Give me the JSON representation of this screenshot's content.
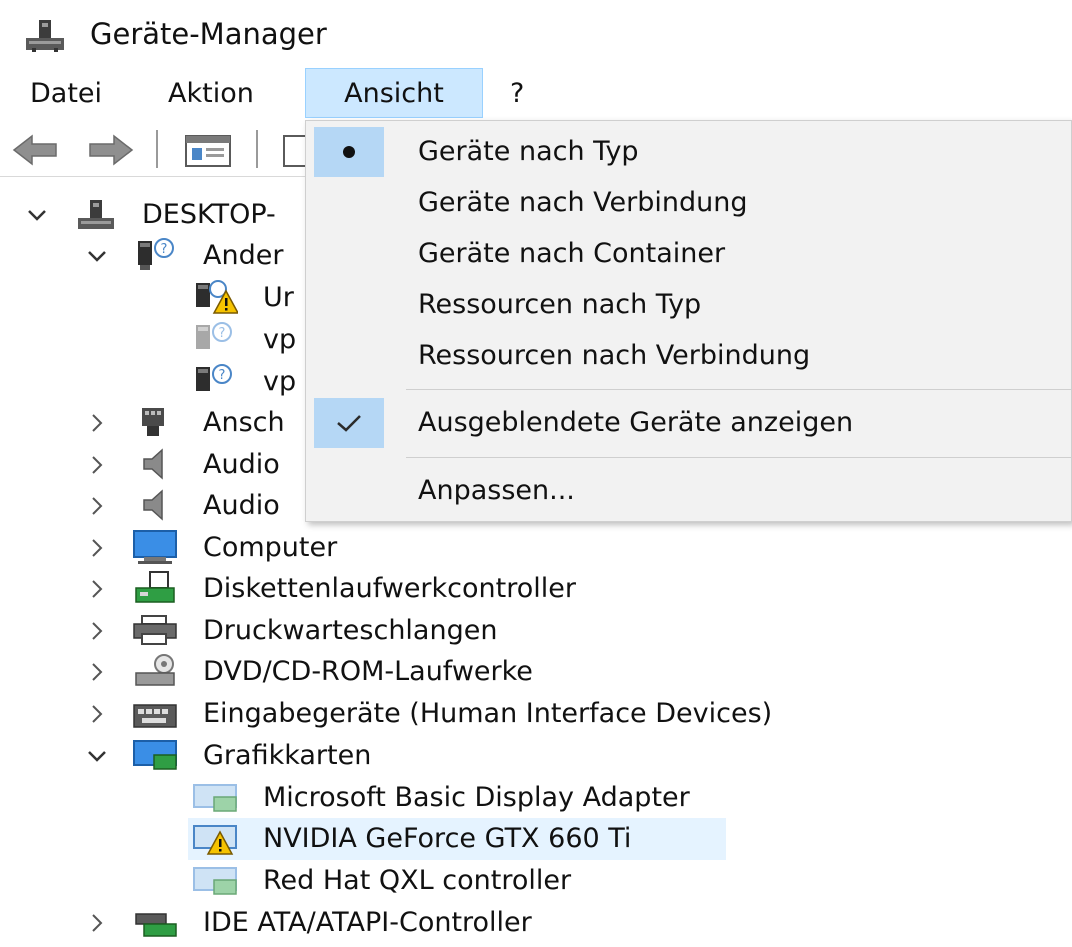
{
  "window": {
    "title": "Geräte-Manager"
  },
  "menubar": {
    "items": [
      "Datei",
      "Aktion",
      "Ansicht",
      "?"
    ]
  },
  "tree": {
    "root": "DESKTOP-",
    "other_devices": "Ander",
    "other_children": [
      "Ur",
      "vp",
      "vp"
    ],
    "categories": [
      "Ansch",
      "Audio",
      "Audio",
      "Computer",
      "Diskettenlaufwerkcontroller",
      "Druckwarteschlangen",
      "DVD/CD-ROM-Laufwerke",
      "Eingabegeräte (Human Interface Devices)",
      "Grafikkarten"
    ],
    "gpu_children": [
      "Microsoft Basic Display Adapter",
      "NVIDIA GeForce GTX 660 Ti",
      "Red Hat QXL controller"
    ],
    "last_category": "IDE ATA/ATAPI-Controller"
  },
  "dropdown": {
    "items": [
      "Geräte nach Typ",
      "Geräte nach Verbindung",
      "Geräte nach Container",
      "Ressourcen nach Typ",
      "Ressourcen nach Verbindung",
      "Ausgeblendete Geräte anzeigen",
      "Anpassen..."
    ]
  },
  "icons": {
    "root": "computer-network-icon",
    "other": "unknown-device-icon",
    "warning": "warning-icon"
  },
  "colors": {
    "menu_active_bg": "#cce8ff",
    "dropdown_bg": "#f2f2f2",
    "dropdown_mark_bg": "#b5d7f5",
    "selected_row_bg": "#e5f3ff"
  }
}
